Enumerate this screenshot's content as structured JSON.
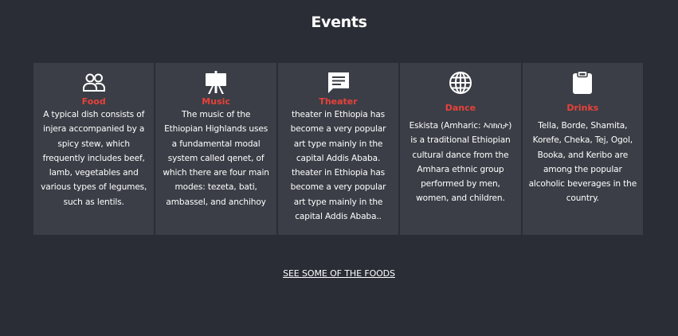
{
  "section": {
    "title": "Events"
  },
  "cards": [
    {
      "title": "Food",
      "icon": "people-icon",
      "text": "A typical dish consists of injera accompanied by a spicy stew, which frequently includes beef, lamb, vegetables and various types of legumes, such as lentils."
    },
    {
      "title": "Music",
      "icon": "easel-icon",
      "text": "The music of the Ethiopian Highlands uses a fundamental modal system called qenet, of which there are four main modes: tezeta, bati, ambassel, and anchihoy"
    },
    {
      "title": "Theater",
      "icon": "chat-icon",
      "text": "theater in Ethiopia has become a very popular art type mainly in the capital Addis Ababa. theater in Ethiopia has become a very popular art type mainly in the capital Addis Ababa.."
    },
    {
      "title": "Dance",
      "icon": "globe-icon",
      "text": "Eskista (Amharic: እስክስታ) is a traditional Ethiopian cultural dance from the Amhara ethnic group performed by men, women, and children."
    },
    {
      "title": "Drinks",
      "icon": "clipboard-icon",
      "text": "Tella, Borde, Shamita, Korefe, Cheka, Tej, Ogol, Booka, and Keribo are among the popular alcoholic beverages in the country."
    }
  ],
  "link": {
    "label": "SEE SOME OF THE FOODS"
  },
  "colors": {
    "background": "#2a2d35",
    "card": "#3b3e46",
    "accent": "#e8413a"
  }
}
